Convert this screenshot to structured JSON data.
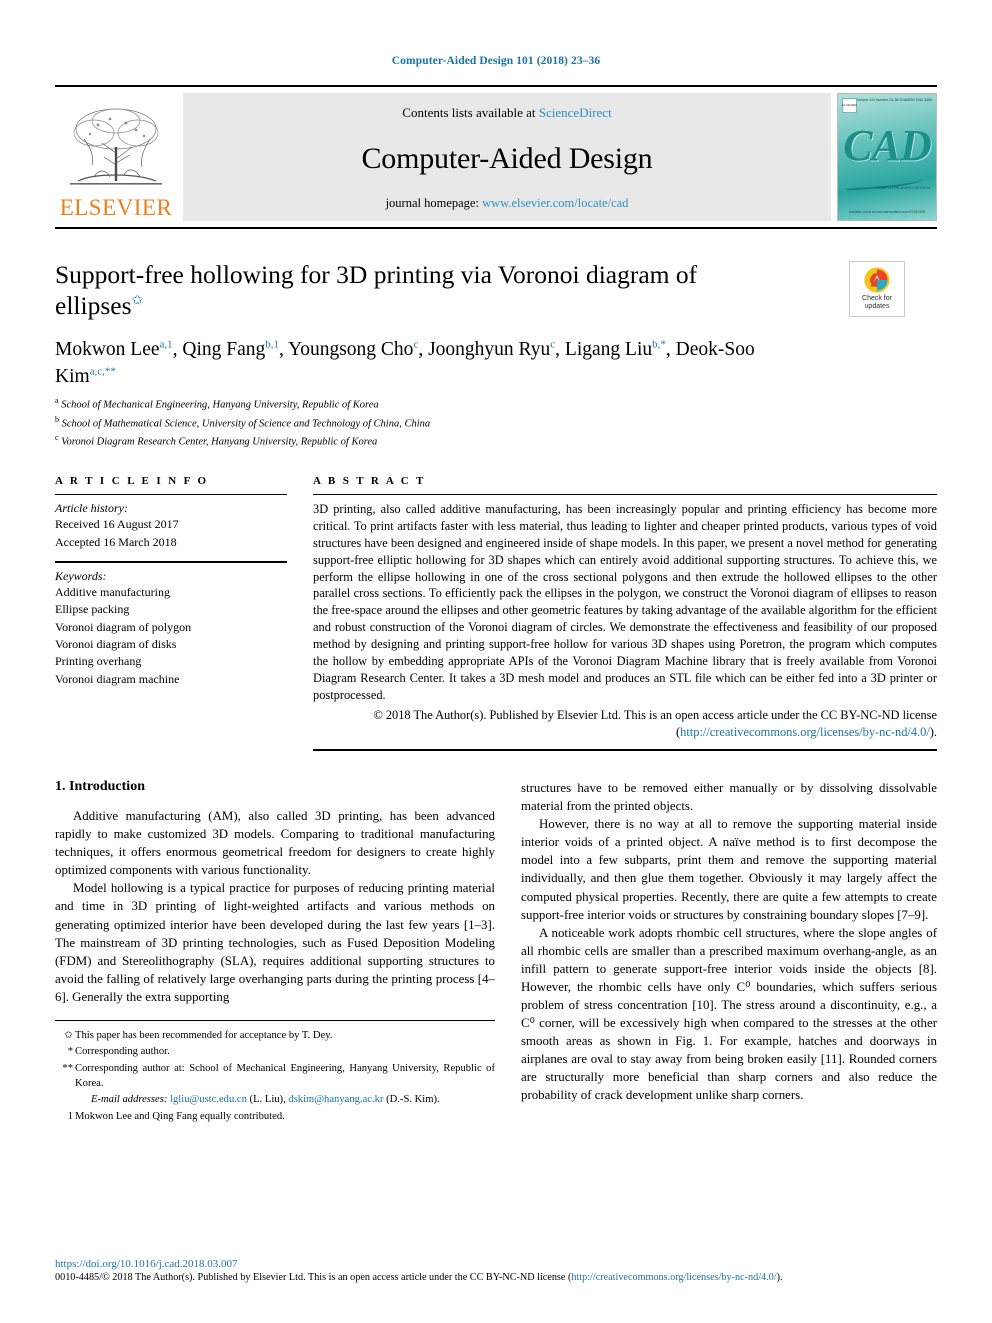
{
  "running_head": "Computer-Aided Design 101 (2018) 23–36",
  "journal_header": {
    "publisher_name": "ELSEVIER",
    "contents_prefix": "Contents lists available at ",
    "contents_link": "ScienceDirect",
    "journal_title": "Computer-Aided Design",
    "homepage_prefix": "journal homepage: ",
    "homepage_url": "www.elsevier.com/locate/cad",
    "cover": {
      "logo_text": "CAD",
      "subtitle": "COMPUTER-AIDED DESIGN",
      "top_left": "ELSEVIER",
      "top_center": "Volume 101  Number 23–36  2018",
      "top_right": "ISSN 0010-4485",
      "bottom": "Available online at www.sciencedirect.com\nELSEVIER"
    }
  },
  "title": {
    "main": "Support-free hollowing for 3D printing via Voronoi diagram of ellipses",
    "star": "✩"
  },
  "crossmark": {
    "line1": "Check for",
    "line2": "updates"
  },
  "authors": {
    "list": [
      {
        "name": "Mokwon Lee",
        "sup": "a,1"
      },
      {
        "name": "Qing Fang",
        "sup": "b,1"
      },
      {
        "name": "Youngsong Cho",
        "sup": "c"
      },
      {
        "name": "Joonghyun Ryu",
        "sup": "c"
      },
      {
        "name": "Ligang Liu",
        "sup": "b,*"
      },
      {
        "name": "Deok-Soo Kim",
        "sup": "a,c,**"
      }
    ],
    "affiliations": [
      {
        "marker": "a",
        "text": "School of Mechanical Engineering, Hanyang University, Republic of Korea"
      },
      {
        "marker": "b",
        "text": "School of Mathematical Science, University of Science and Technology of China, China"
      },
      {
        "marker": "c",
        "text": "Voronoi Diagram Research Center, Hanyang University, Republic of Korea"
      }
    ]
  },
  "article_info": {
    "heading": "A R T I C L E    I N F O",
    "history_label": "Article history:",
    "history": [
      "Received 16 August 2017",
      "Accepted 16 March 2018"
    ],
    "keywords_label": "Keywords:",
    "keywords": [
      "Additive manufacturing",
      "Ellipse packing",
      "Voronoi diagram of polygon",
      "Voronoi diagram of disks",
      "Printing overhang",
      "Voronoi diagram machine"
    ]
  },
  "abstract": {
    "heading": "A B S T R A C T",
    "body": "3D printing, also called additive manufacturing, has been increasingly popular and printing efficiency has become more critical. To print artifacts faster with less material, thus leading to lighter and cheaper printed products, various types of void structures have been designed and engineered inside of shape models. In this paper, we present a novel method for generating support-free elliptic hollowing for 3D shapes which can entirely avoid additional supporting structures. To achieve this, we perform the ellipse hollowing in one of the cross sectional polygons and then extrude the hollowed ellipses to the other parallel cross sections. To efficiently pack the ellipses in the polygon, we construct the Voronoi diagram of ellipses to reason the free-space around the ellipses and other geometric features by taking advantage of the available algorithm for the efficient and robust construction of the Voronoi diagram of circles. We demonstrate the effectiveness and feasibility of our proposed method by designing and printing support-free hollow for various 3D shapes using Poretron, the program which computes the hollow by embedding appropriate APIs of the Voronoi Diagram Machine library that is freely available from Voronoi Diagram Research Center. It takes a 3D mesh model and produces an STL file which can be either fed into a 3D printer or postprocessed.",
    "copyright_text": "© 2018 The Author(s). Published by Elsevier Ltd. This is an open access article under the CC BY-NC-ND license (",
    "copyright_link": "http://creativecommons.org/licenses/by-nc-nd/4.0/",
    "copyright_tail": ")."
  },
  "body": {
    "section_number_title": "1.  Introduction",
    "left_paragraphs": [
      "Additive manufacturing (AM), also called 3D printing, has been advanced rapidly to make customized 3D models. Comparing to traditional manufacturing techniques, it offers enormous geometrical freedom for designers to create highly optimized components with various functionality.",
      "Model hollowing is a typical practice for purposes of reducing printing material and time in 3D printing of light-weighted artifacts and various methods on generating optimized interior have been developed during the last few years [1–3]. The mainstream of 3D printing technologies, such as Fused Deposition Modeling (FDM) and Stereolithography (SLA), requires additional supporting structures to avoid the falling of relatively large overhanging parts during the printing process [4–6]. Generally the extra supporting"
    ],
    "right_paragraphs": [
      "structures have to be removed either manually or by dissolving dissolvable material from the printed objects.",
      "However, there is no way at all to remove the supporting material inside interior voids of a printed object. A naïve method is to first decompose the model into a few subparts, print them and remove the supporting material individually, and then glue them together. Obviously it may largely affect the computed physical properties. Recently, there are quite a few attempts to create support-free interior voids or structures by constraining boundary slopes [7–9].",
      "A noticeable work adopts rhombic cell structures, where the slope angles of all rhombic cells are smaller than a prescribed maximum overhang-angle, as an infill pattern to generate support-free interior voids inside the objects [8]. However, the rhombic cells have only C⁰ boundaries, which suffers serious problem of stress concentration [10]. The stress around a discontinuity, e.g., a C⁰ corner, will be excessively high when compared to the stresses at the other smooth areas as shown in Fig. 1. For example, hatches and doorways in airplanes are oval to stay away from being broken easily [11]. Rounded corners are structurally more beneficial than sharp corners and also reduce the probability of crack development unlike sharp corners."
    ]
  },
  "footnotes": [
    {
      "marker": "✩",
      "text": "This paper has been recommended for acceptance by T. Dey."
    },
    {
      "marker": "*",
      "text": "Corresponding author."
    },
    {
      "marker": "**",
      "text": "Corresponding author at: School of Mechanical Engineering, Hanyang University, Republic of Korea."
    },
    {
      "marker": "",
      "label": "E-mail addresses:",
      "email1": "lgliu@ustc.edu.cn",
      "email1_owner": " (L. Liu), ",
      "email2": "dskim@hanyang.ac.kr",
      "email2_owner": " (D.-S. Kim)."
    },
    {
      "marker": "1",
      "text": "Mokwon Lee and Qing Fang equally contributed."
    }
  ],
  "page_footer": {
    "doi": "https://doi.org/10.1016/j.cad.2018.03.007",
    "issn_text": "0010-4485/© 2018 The Author(s). Published by Elsevier Ltd. This is an open access article under the CC BY-NC-ND license (",
    "issn_link": "http://creativecommons.org/licenses/by-nc-nd/4.0/",
    "issn_tail": ")."
  },
  "colors": {
    "link": "#1a74a8",
    "elsevier_orange": "#f07f1a",
    "band_gray": "#e8e8e8",
    "cover_teal": "#2ba6a0"
  }
}
